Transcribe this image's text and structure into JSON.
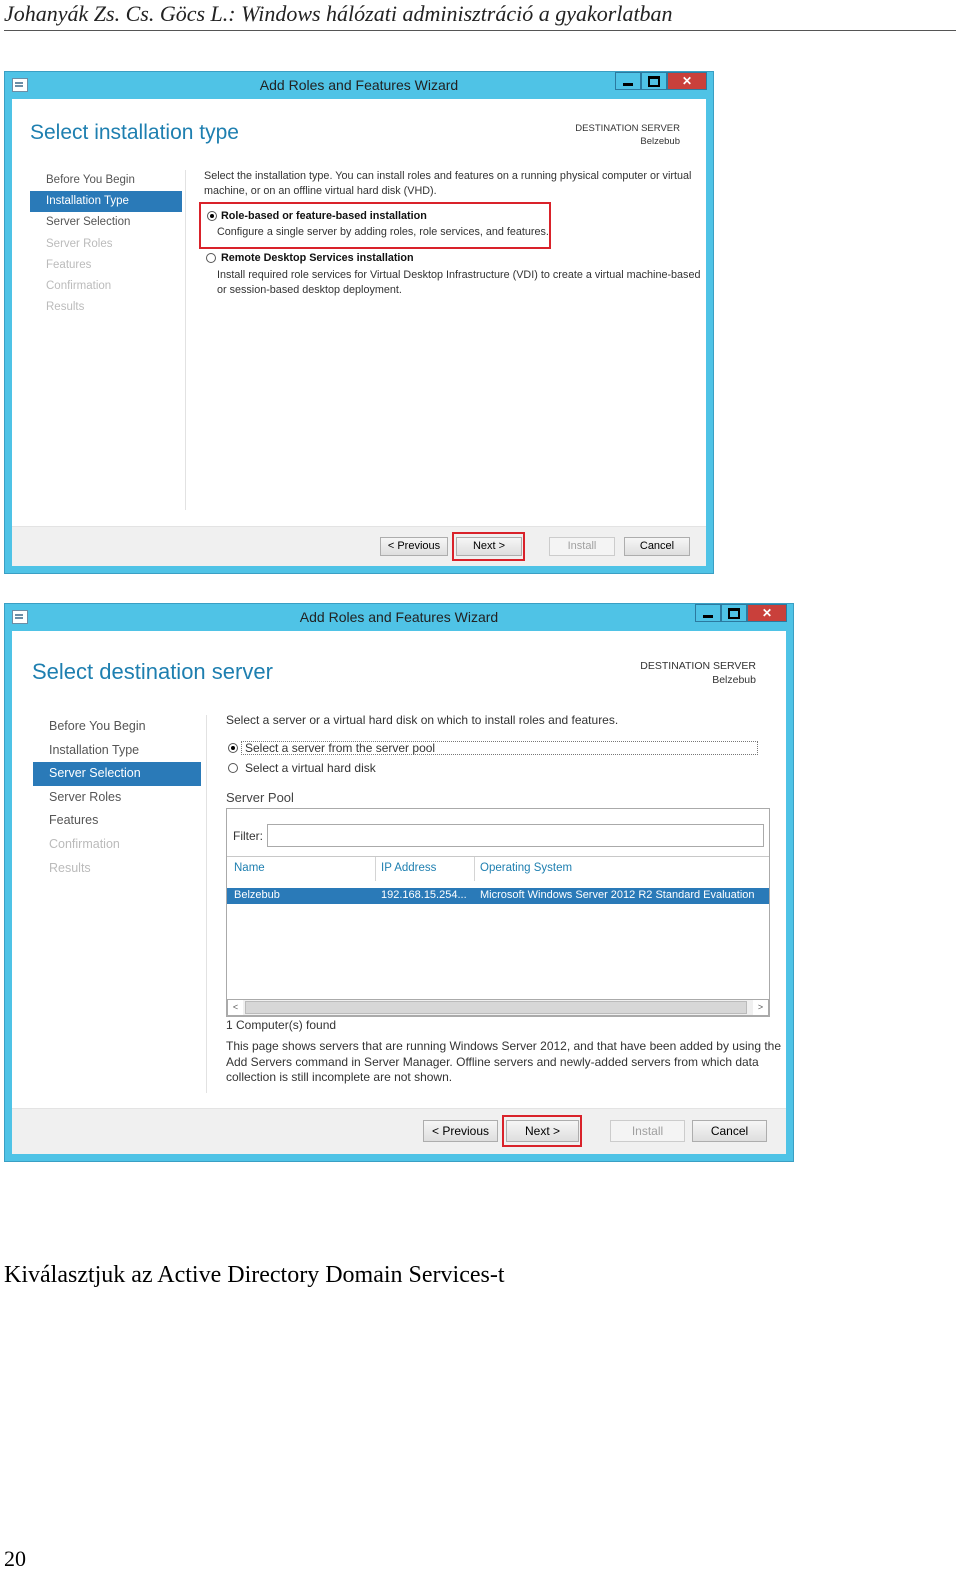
{
  "page_header": "Johanyák Zs. Cs. Göcs L.: Windows hálózati adminisztráció a gyakorlatban",
  "wizard1": {
    "title": "Add Roles and Features Wizard",
    "heading": "Select installation type",
    "dest_label": "DESTINATION SERVER",
    "dest_name": "Belzebub",
    "nav": [
      "Before You Begin",
      "Installation Type",
      "Server Selection",
      "Server Roles",
      "Features",
      "Confirmation",
      "Results"
    ],
    "intro_line1": "Select the installation type. You can install roles and features on a running physical computer or virtual",
    "intro_line2": "machine, or on an offline virtual hard disk (VHD).",
    "option1_title": "Role-based or feature-based installation",
    "option1_desc": "Configure a single server by adding roles, role services, and features.",
    "option2_title": "Remote Desktop Services installation",
    "option2_desc1": "Install required role services for Virtual Desktop Infrastructure (VDI) to create a virtual machine-based",
    "option2_desc2": "or session-based desktop deployment.",
    "buttons": {
      "previous": "< Previous",
      "next": "Next >",
      "install": "Install",
      "cancel": "Cancel"
    }
  },
  "wizard2": {
    "title": "Add Roles and Features Wizard",
    "heading": "Select destination server",
    "dest_label": "DESTINATION SERVER",
    "dest_name": "Belzebub",
    "nav": [
      "Before You Begin",
      "Installation Type",
      "Server Selection",
      "Server Roles",
      "Features",
      "Confirmation",
      "Results"
    ],
    "intro": "Select a server or a virtual hard disk on which to install roles and features.",
    "radio1": "Select a server from the server pool",
    "radio2": "Select a virtual hard disk",
    "pool_label": "Server Pool",
    "filter_label": "Filter:",
    "columns": [
      "Name",
      "IP Address",
      "Operating System"
    ],
    "row": {
      "name": "Belzebub",
      "ip": "192.168.15.254...",
      "os": "Microsoft Windows Server 2012 R2 Standard Evaluation"
    },
    "count": "1 Computer(s) found",
    "note1": "This page shows servers that are running Windows Server 2012, and that have been added by using the",
    "note2": "Add Servers command in Server Manager. Offline servers and newly-added servers from which data",
    "note3": "collection is still incomplete are not shown.",
    "buttons": {
      "previous": "< Previous",
      "next": "Next >",
      "install": "Install",
      "cancel": "Cancel"
    }
  },
  "caption": "Kiválasztjuk az Active Directory Domain Services-t",
  "page_number": "20"
}
